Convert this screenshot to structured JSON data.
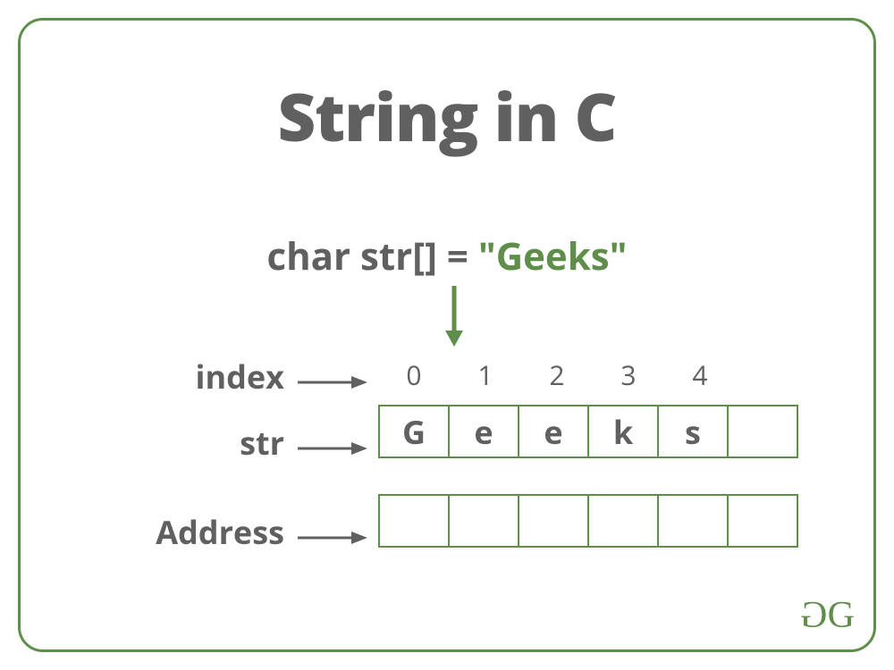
{
  "title": "String in C",
  "declaration_prefix": "char str[] = ",
  "declaration_literal": "\"Geeks\"",
  "labels": {
    "index": "index",
    "str": "str",
    "address": "Address"
  },
  "indices": [
    "0",
    "1",
    "2",
    "3",
    "4",
    ""
  ],
  "str_cells": [
    "G",
    "e",
    "e",
    "k",
    "s",
    ""
  ],
  "addr_cells": [
    "",
    "",
    "",
    "",
    "",
    ""
  ],
  "logo_text": "GG",
  "colors": {
    "border": "#5f8e4a",
    "text": "#606060"
  }
}
